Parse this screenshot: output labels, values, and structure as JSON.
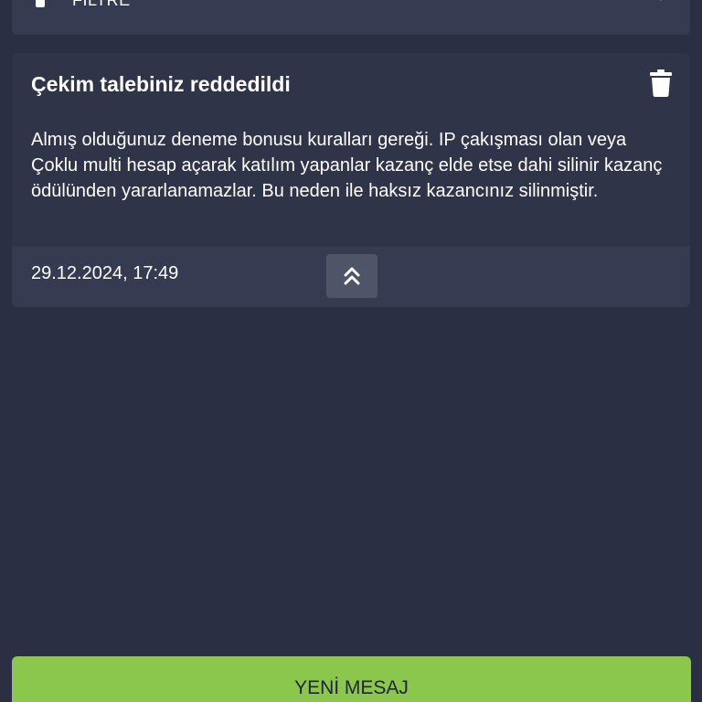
{
  "filter": {
    "label": "FİLTRE",
    "icon": "filter-icon",
    "chevron_icon": "chevron-down-icon"
  },
  "message": {
    "title": "Çekim talebiniz reddedildi",
    "body": "Almış olduğunuz deneme bonusu kuralları gereği. IP çakışması olan veya Çoklu multi hesap açarak katılım yapanlar kazanç elde etse dahi silinir kazanç ödülünden yararlanamazlar. Bu neden ile haksız kazancınız silinmiştir.",
    "date": "29.12.2024, 17:49",
    "delete_icon": "trash-icon",
    "collapse_icon": "double-chevron-up-icon"
  },
  "actions": {
    "new_message_label": "YENİ MESAJ"
  },
  "colors": {
    "background": "#2a2f43",
    "card": "#2f3448",
    "card_footer": "#353b50",
    "accent_green": "#8bc64d"
  }
}
